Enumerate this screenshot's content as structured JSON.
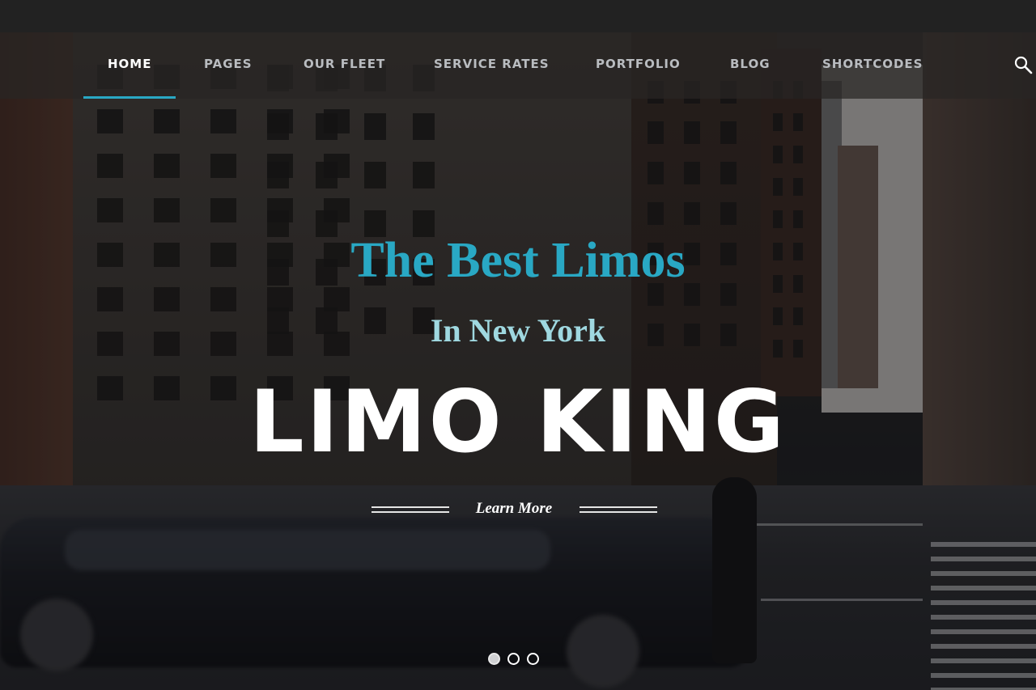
{
  "colors": {
    "accent": "#29a8c4",
    "nav_text": "#b9bcc0",
    "nav_active": "#ffffff",
    "subtitle": "#9fd8e0"
  },
  "nav": {
    "items": [
      {
        "label": "HOME",
        "active": true
      },
      {
        "label": "PAGES",
        "active": false
      },
      {
        "label": "OUR FLEET",
        "active": false
      },
      {
        "label": "SERVICE RATES",
        "active": false
      },
      {
        "label": "PORTFOLIO",
        "active": false
      },
      {
        "label": "BLOG",
        "active": false
      },
      {
        "label": "SHORTCODES",
        "active": false
      }
    ],
    "search_icon": "search-icon"
  },
  "hero": {
    "headline": "The Best Limos",
    "subheadline": "In New York",
    "brand": "LIMO KING",
    "cta": "Learn More"
  },
  "slider": {
    "slide_count": 3,
    "active_index": 0
  }
}
